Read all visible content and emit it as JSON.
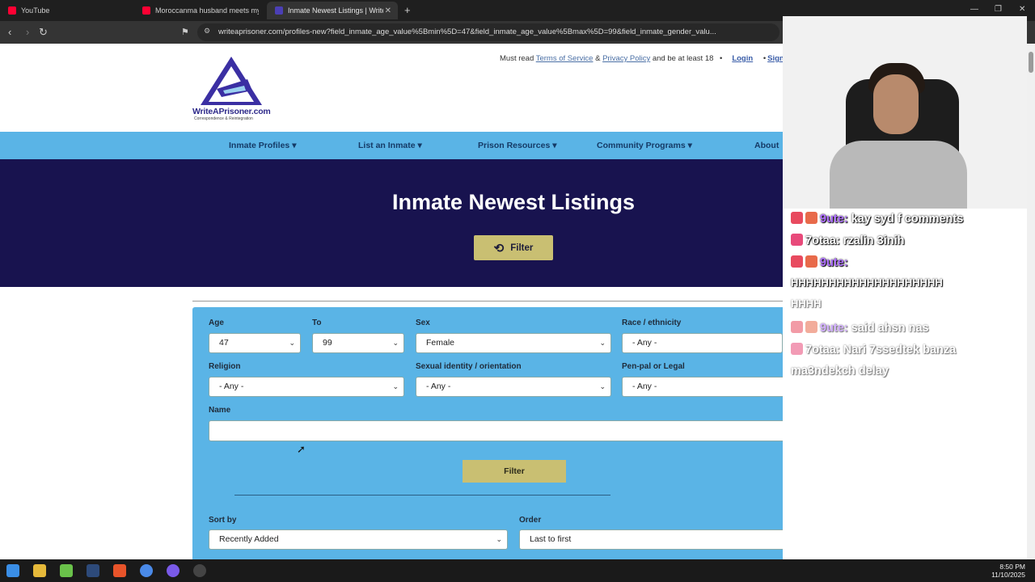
{
  "browser": {
    "tabs": [
      {
        "title": "YouTube",
        "favicon_color": "#ff0033"
      },
      {
        "title": "Moroccanma husband meets my Me",
        "favicon_color": "#ff0033"
      },
      {
        "title": "Inmate Newest Listings | WriteA",
        "favicon_color": "#4b3fb5",
        "active": true
      }
    ],
    "url": "writeaprisoner.com/profiles-new?field_inmate_age_value%5Bmin%5D=47&field_inmate_age_value%5Bmax%5D=99&field_inmate_gender_valu..."
  },
  "site": {
    "notice_prefix": "Must read",
    "tos_label": "Terms of Service",
    "amp": "&",
    "privacy_label": "Privacy Policy",
    "notice_suffix": "and be at least 18",
    "login_label": "Login",
    "signup_label": "Sign",
    "brand": "WriteAPrisoner.com",
    "tagline": "Correspondence & Reintegration",
    "nav": [
      "Inmate Profiles",
      "List an Inmate",
      "Prison Resources",
      "Community Programs",
      "About"
    ],
    "hero_title": "Inmate Newest Listings",
    "hero_filter_label": "Filter"
  },
  "form": {
    "age_label": "Age",
    "age_value": "47",
    "to_label": "To",
    "to_value": "99",
    "sex_label": "Sex",
    "sex_value": "Female",
    "race_label": "Race / ethnicity",
    "race_value": "- Any -",
    "religion_label": "Religion",
    "religion_value": "- Any -",
    "orientation_label": "Sexual identity / orientation",
    "orientation_value": "- Any -",
    "penpal_label": "Pen-pal or Legal",
    "penpal_value": "- Any -",
    "name_label": "Name",
    "name_value": "",
    "filter_label": "Filter",
    "sortby_label": "Sort by",
    "sortby_value": "Recently Added",
    "order_label": "Order",
    "order_value": "Last to first"
  },
  "chat": [
    {
      "user": "9ute:",
      "message": "kay syd f comments"
    },
    {
      "user": "7otaa:",
      "message": "rzalin 3inih"
    },
    {
      "user": "9ute:",
      "message": ""
    },
    {
      "user": "",
      "message": "HHHHHHHHHHHHHHHHHHHH"
    },
    {
      "user": "",
      "message": "HHHH"
    },
    {
      "user": "9ute:",
      "message": "said ahsn nas"
    },
    {
      "user": "7otaa:",
      "message": "Nari 7ssedtek banza"
    },
    {
      "user": "",
      "message": "ma3ndekch delay"
    }
  ],
  "clock": {
    "time": "8:50 PM",
    "date": "11/10/2025"
  }
}
